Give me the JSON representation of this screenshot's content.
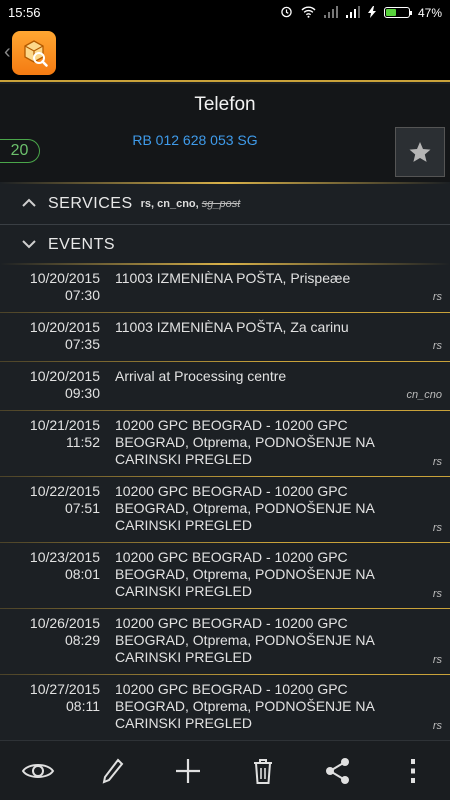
{
  "status_bar": {
    "time": "15:56",
    "battery_percent": "47%",
    "battery_level": 0.47
  },
  "item": {
    "title": "Telefon",
    "count": "20",
    "tracking_number": "RB 012 628 053 SG"
  },
  "services": {
    "title": "SERVICES",
    "tags": "rs, cn_cno,",
    "struck_tag": "sg_post"
  },
  "events_section": {
    "title": "EVENTS"
  },
  "events": [
    {
      "date": "10/20/2015",
      "time": "07:30",
      "description": "11003 IZMENIÈNA POŠTA, Prispeæe",
      "service": "rs"
    },
    {
      "date": "10/20/2015",
      "time": "07:35",
      "description": "11003 IZMENIÈNA POŠTA, Za carinu",
      "service": "rs"
    },
    {
      "date": "10/20/2015",
      "time": "09:30",
      "description": "Arrival at Processing centre",
      "service": "cn_cno"
    },
    {
      "date": "10/21/2015",
      "time": "11:52",
      "description": "10200 GPC BEOGRAD - 10200 GPC BEOGRAD, Otprema, PODNOŠENJE NA CARINSKI PREGLED",
      "service": "rs"
    },
    {
      "date": "10/22/2015",
      "time": "07:51",
      "description": "10200 GPC BEOGRAD - 10200 GPC BEOGRAD, Otprema, PODNOŠENJE NA CARINSKI PREGLED",
      "service": "rs"
    },
    {
      "date": "10/23/2015",
      "time": "08:01",
      "description": "10200 GPC BEOGRAD - 10200 GPC BEOGRAD, Otprema, PODNOŠENJE NA CARINSKI PREGLED",
      "service": "rs"
    },
    {
      "date": "10/26/2015",
      "time": "08:29",
      "description": "10200 GPC BEOGRAD - 10200 GPC BEOGRAD, Otprema, PODNOŠENJE NA CARINSKI PREGLED",
      "service": "rs"
    },
    {
      "date": "10/27/2015",
      "time": "08:11",
      "description": "10200 GPC BEOGRAD - 10200 GPC BEOGRAD, Otprema, PODNOŠENJE NA CARINSKI PREGLED",
      "service": "rs"
    }
  ],
  "toolbar": {
    "icons": [
      "eye-icon",
      "pencil-icon",
      "plus-icon",
      "trash-icon",
      "share-icon",
      "overflow-menu-icon"
    ]
  }
}
